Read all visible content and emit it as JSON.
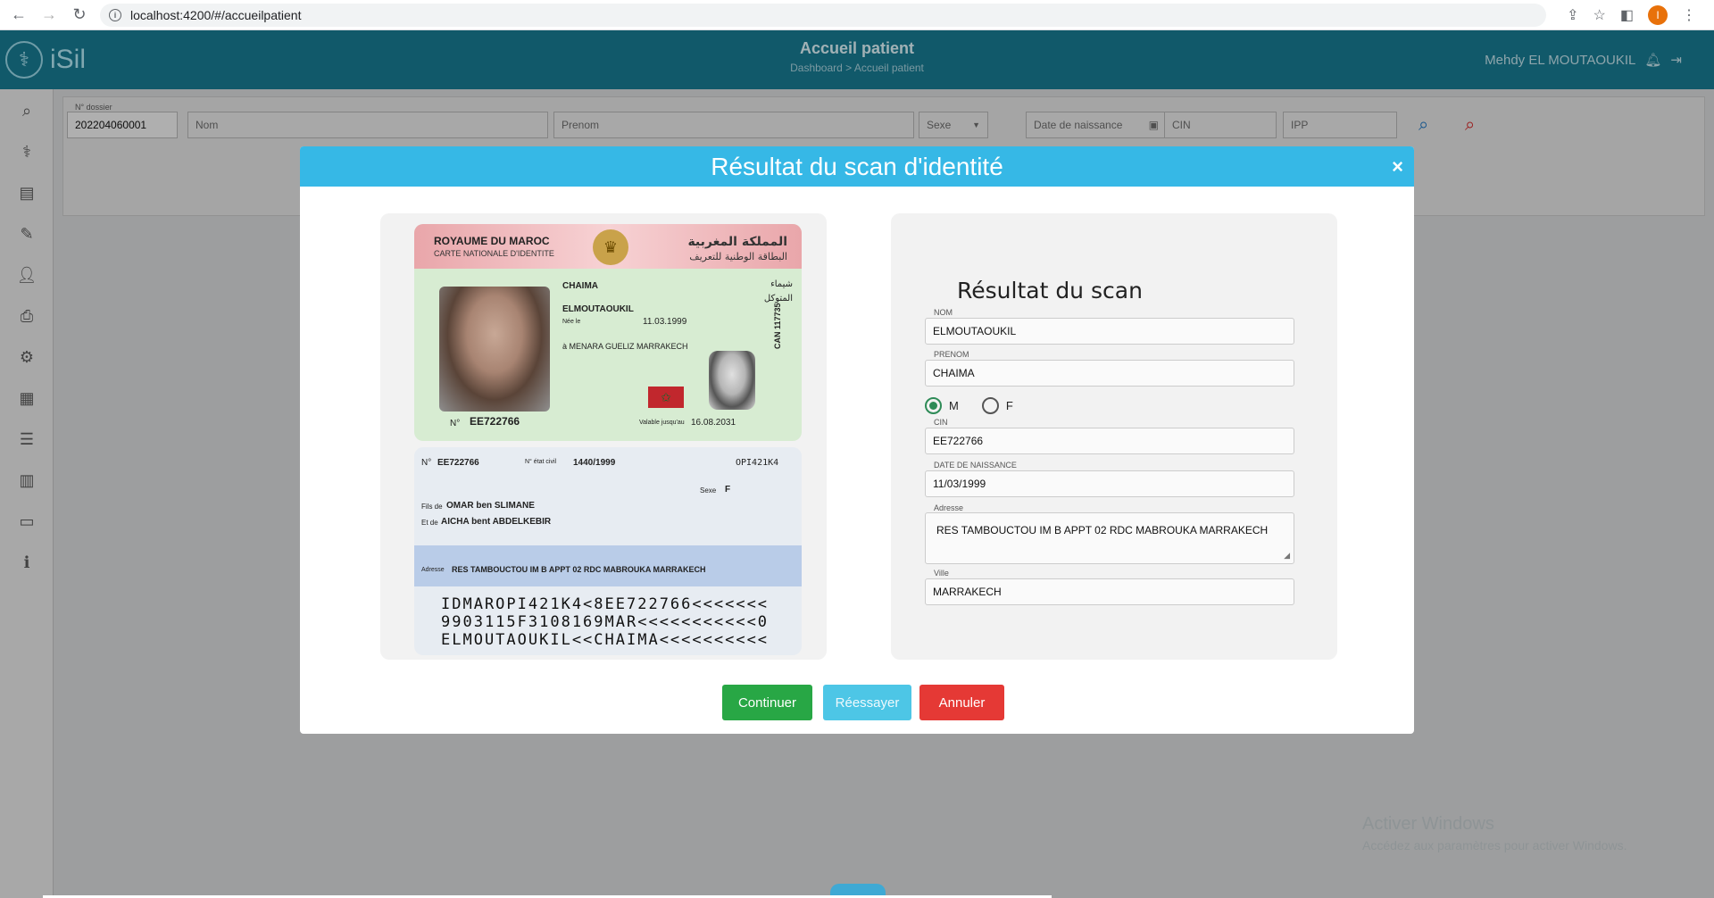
{
  "browser": {
    "url": "localhost:4200/#/accueilpatient",
    "profile_initial": "I"
  },
  "app": {
    "logo_text": "iSil",
    "title": "Accueil patient",
    "breadcrumb": "Dashboard > Accueil patient",
    "user_name": "Mehdy EL MOUTAOUKIL"
  },
  "search": {
    "dossier_label": "N° dossier",
    "dossier_value": "202204060001",
    "nom_placeholder": "Nom",
    "prenom_placeholder": "Prenom",
    "sexe_placeholder": "Sexe",
    "dob_placeholder": "Date de naissance",
    "cin_placeholder": "CIN",
    "ipp_placeholder": "IPP"
  },
  "modal": {
    "title": "Résultat du scan d'identité",
    "close": "×",
    "result_title": "Résultat du scan",
    "fields": {
      "nom_label": "NOM",
      "nom_value": "ELMOUTAOUKIL",
      "prenom_label": "PRENOM",
      "prenom_value": "CHAIMA",
      "sex_m": "M",
      "sex_f": "F",
      "cin_label": "CIN",
      "cin_value": "EE722766",
      "dob_label": "DATE DE NAISSANCE",
      "dob_value": "11/03/1999",
      "adresse_label": "Adresse",
      "adresse_value": "RES TAMBOUCTOU IM B APPT 02 RDC MABROUKA MARRAKECH",
      "ville_label": "Ville",
      "ville_value": "MARRAKECH"
    },
    "buttons": {
      "continue": "Continuer",
      "retry": "Réessayer",
      "cancel": "Annuler"
    }
  },
  "id_card": {
    "front": {
      "country_fr": "ROYAUME DU MAROC",
      "card_fr": "CARTE NATIONALE D'IDENTITE",
      "country_ar": "المملكة المغربية",
      "card_ar": "البطاقة الوطنية للتعريف",
      "first_name": "CHAIMA",
      "first_name_ar": "شيماء",
      "last_name": "ELMOUTAOUKIL",
      "last_name_ar": "المتوكل",
      "born_label": "Née le",
      "birth_date": "11.03.1999",
      "birth_place": "à MENARA GUELIZ MARRAKECH",
      "number_label": "N°",
      "number": "EE722766",
      "valid_label": "Valable jusqu'au",
      "valid_until": "16.08.2031",
      "can": "CAN 117735"
    },
    "back": {
      "number": "EE722766",
      "civil_label": "N° état civil",
      "civil": "1440/1999",
      "code": "OPI421K4",
      "father_label": "Fils de",
      "father": "OMAR ben SLIMANE",
      "mother_label": "Et de",
      "mother": "AICHA bent ABDELKEBIR",
      "sex_label": "Sexe",
      "sex": "F",
      "address_label": "Adresse",
      "address": "RES TAMBOUCTOU IM B APPT 02 RDC MABROUKA MARRAKECH",
      "mrz1": "IDMAROPI421K4<8EE722766<<<<<<<",
      "mrz2": "9903115F3108169MAR<<<<<<<<<<<0",
      "mrz3": "ELMOUTAOUKIL<<CHAIMA<<<<<<<<<<"
    }
  },
  "watermark": {
    "line1": "Activer Windows",
    "line2": "Accédez aux paramètres pour activer Windows."
  },
  "colors": {
    "header": "#177288",
    "modal_header": "#36b8e6",
    "continue": "#28a745",
    "retry": "#4dc6e6",
    "cancel": "#e53935"
  }
}
